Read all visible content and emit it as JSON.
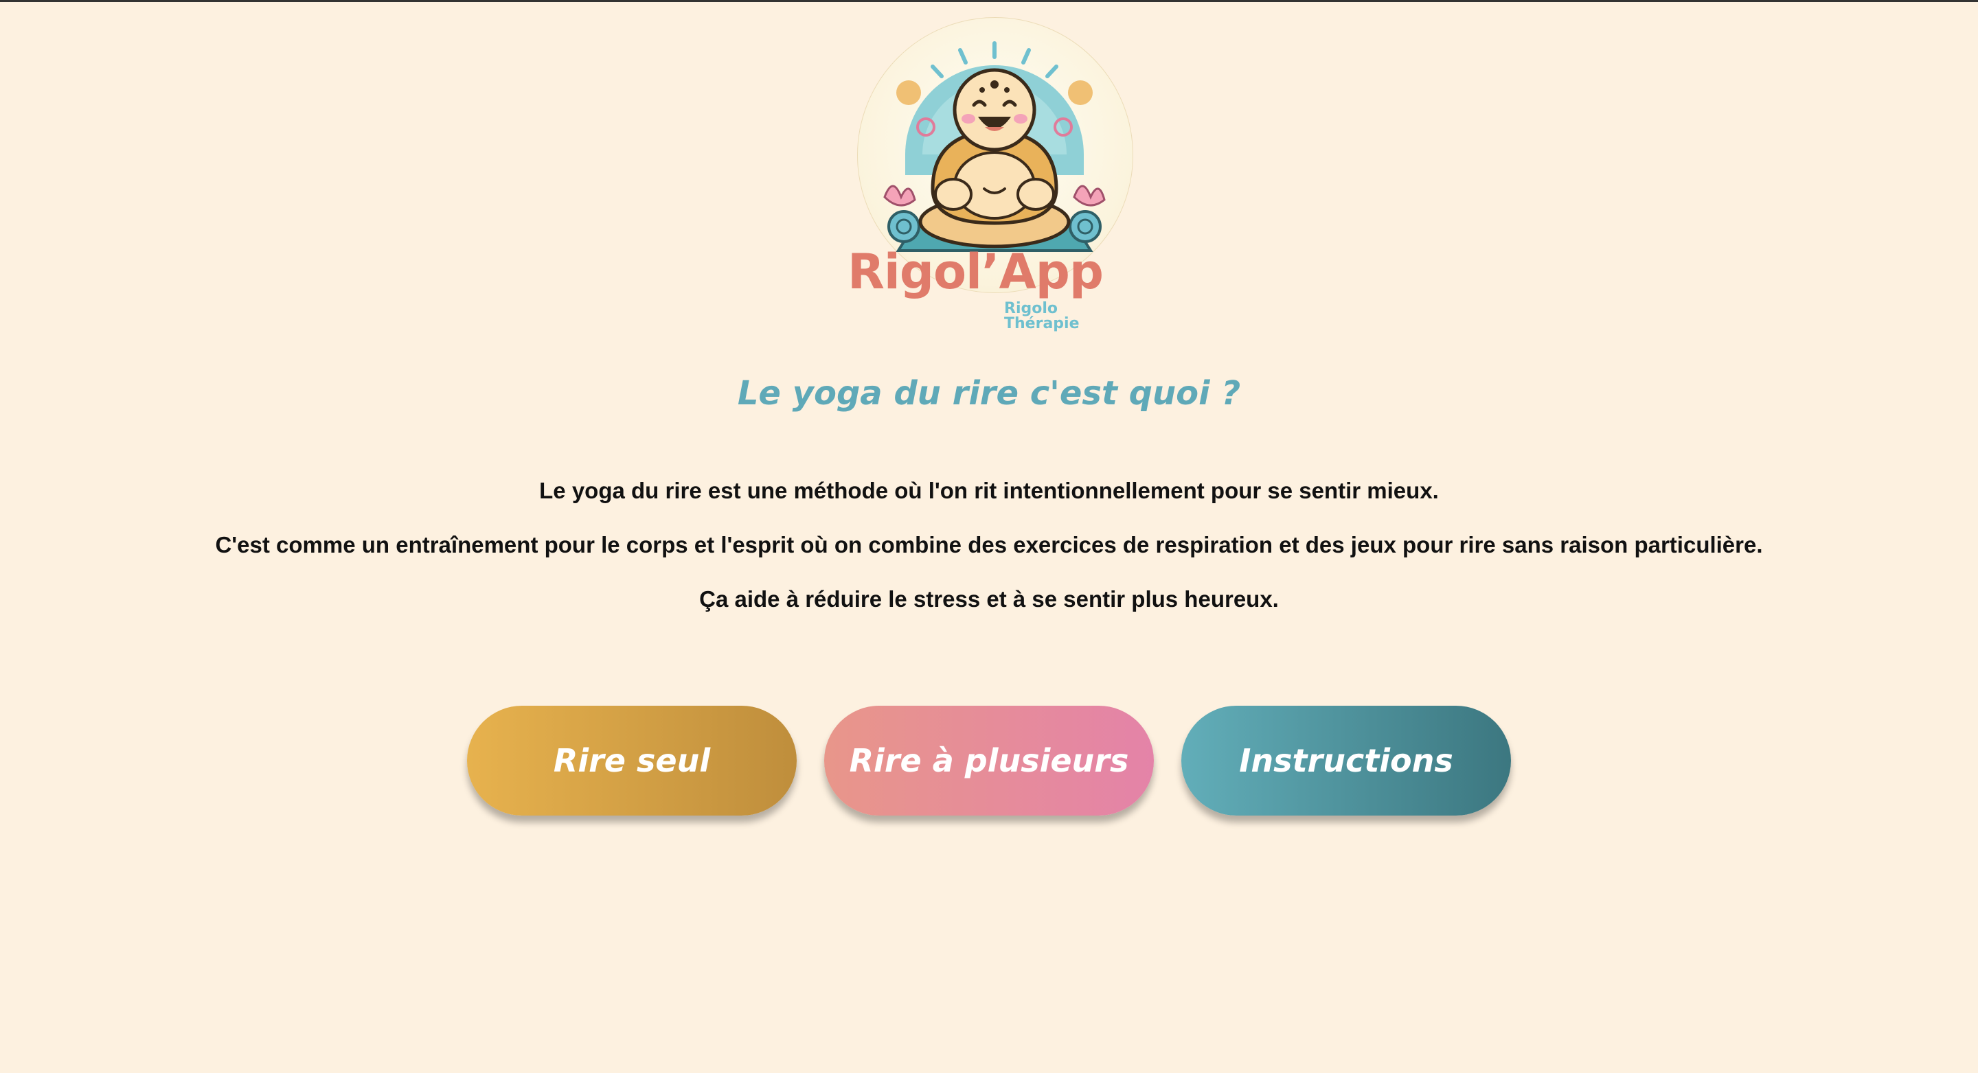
{
  "logo": {
    "title": "Rigol’App",
    "subtitle": "Rigolo Thérapie"
  },
  "heading": "Le yoga du rire c'est quoi ?",
  "paragraphs": [
    "Le yoga du rire est une méthode où l'on rit intentionnellement pour se sentir mieux.",
    "C'est comme un entraînement pour le corps et l'esprit où on combine des exercices de respiration et des jeux pour rire sans raison particulière.",
    "Ça aide à réduire le stress et à se sentir plus heureux."
  ],
  "buttons": {
    "alone": "Rire seul",
    "group": "Rire à plusieurs",
    "instructions": "Instructions"
  },
  "colors": {
    "background": "#fdf1e0",
    "heading": "#5fa9b8",
    "logo_title": "#e07b6a",
    "logo_subtitle": "#6fc0cf",
    "button_alone": "#d9a246",
    "button_group": "#e68d98",
    "button_instructions": "#4f939d"
  }
}
